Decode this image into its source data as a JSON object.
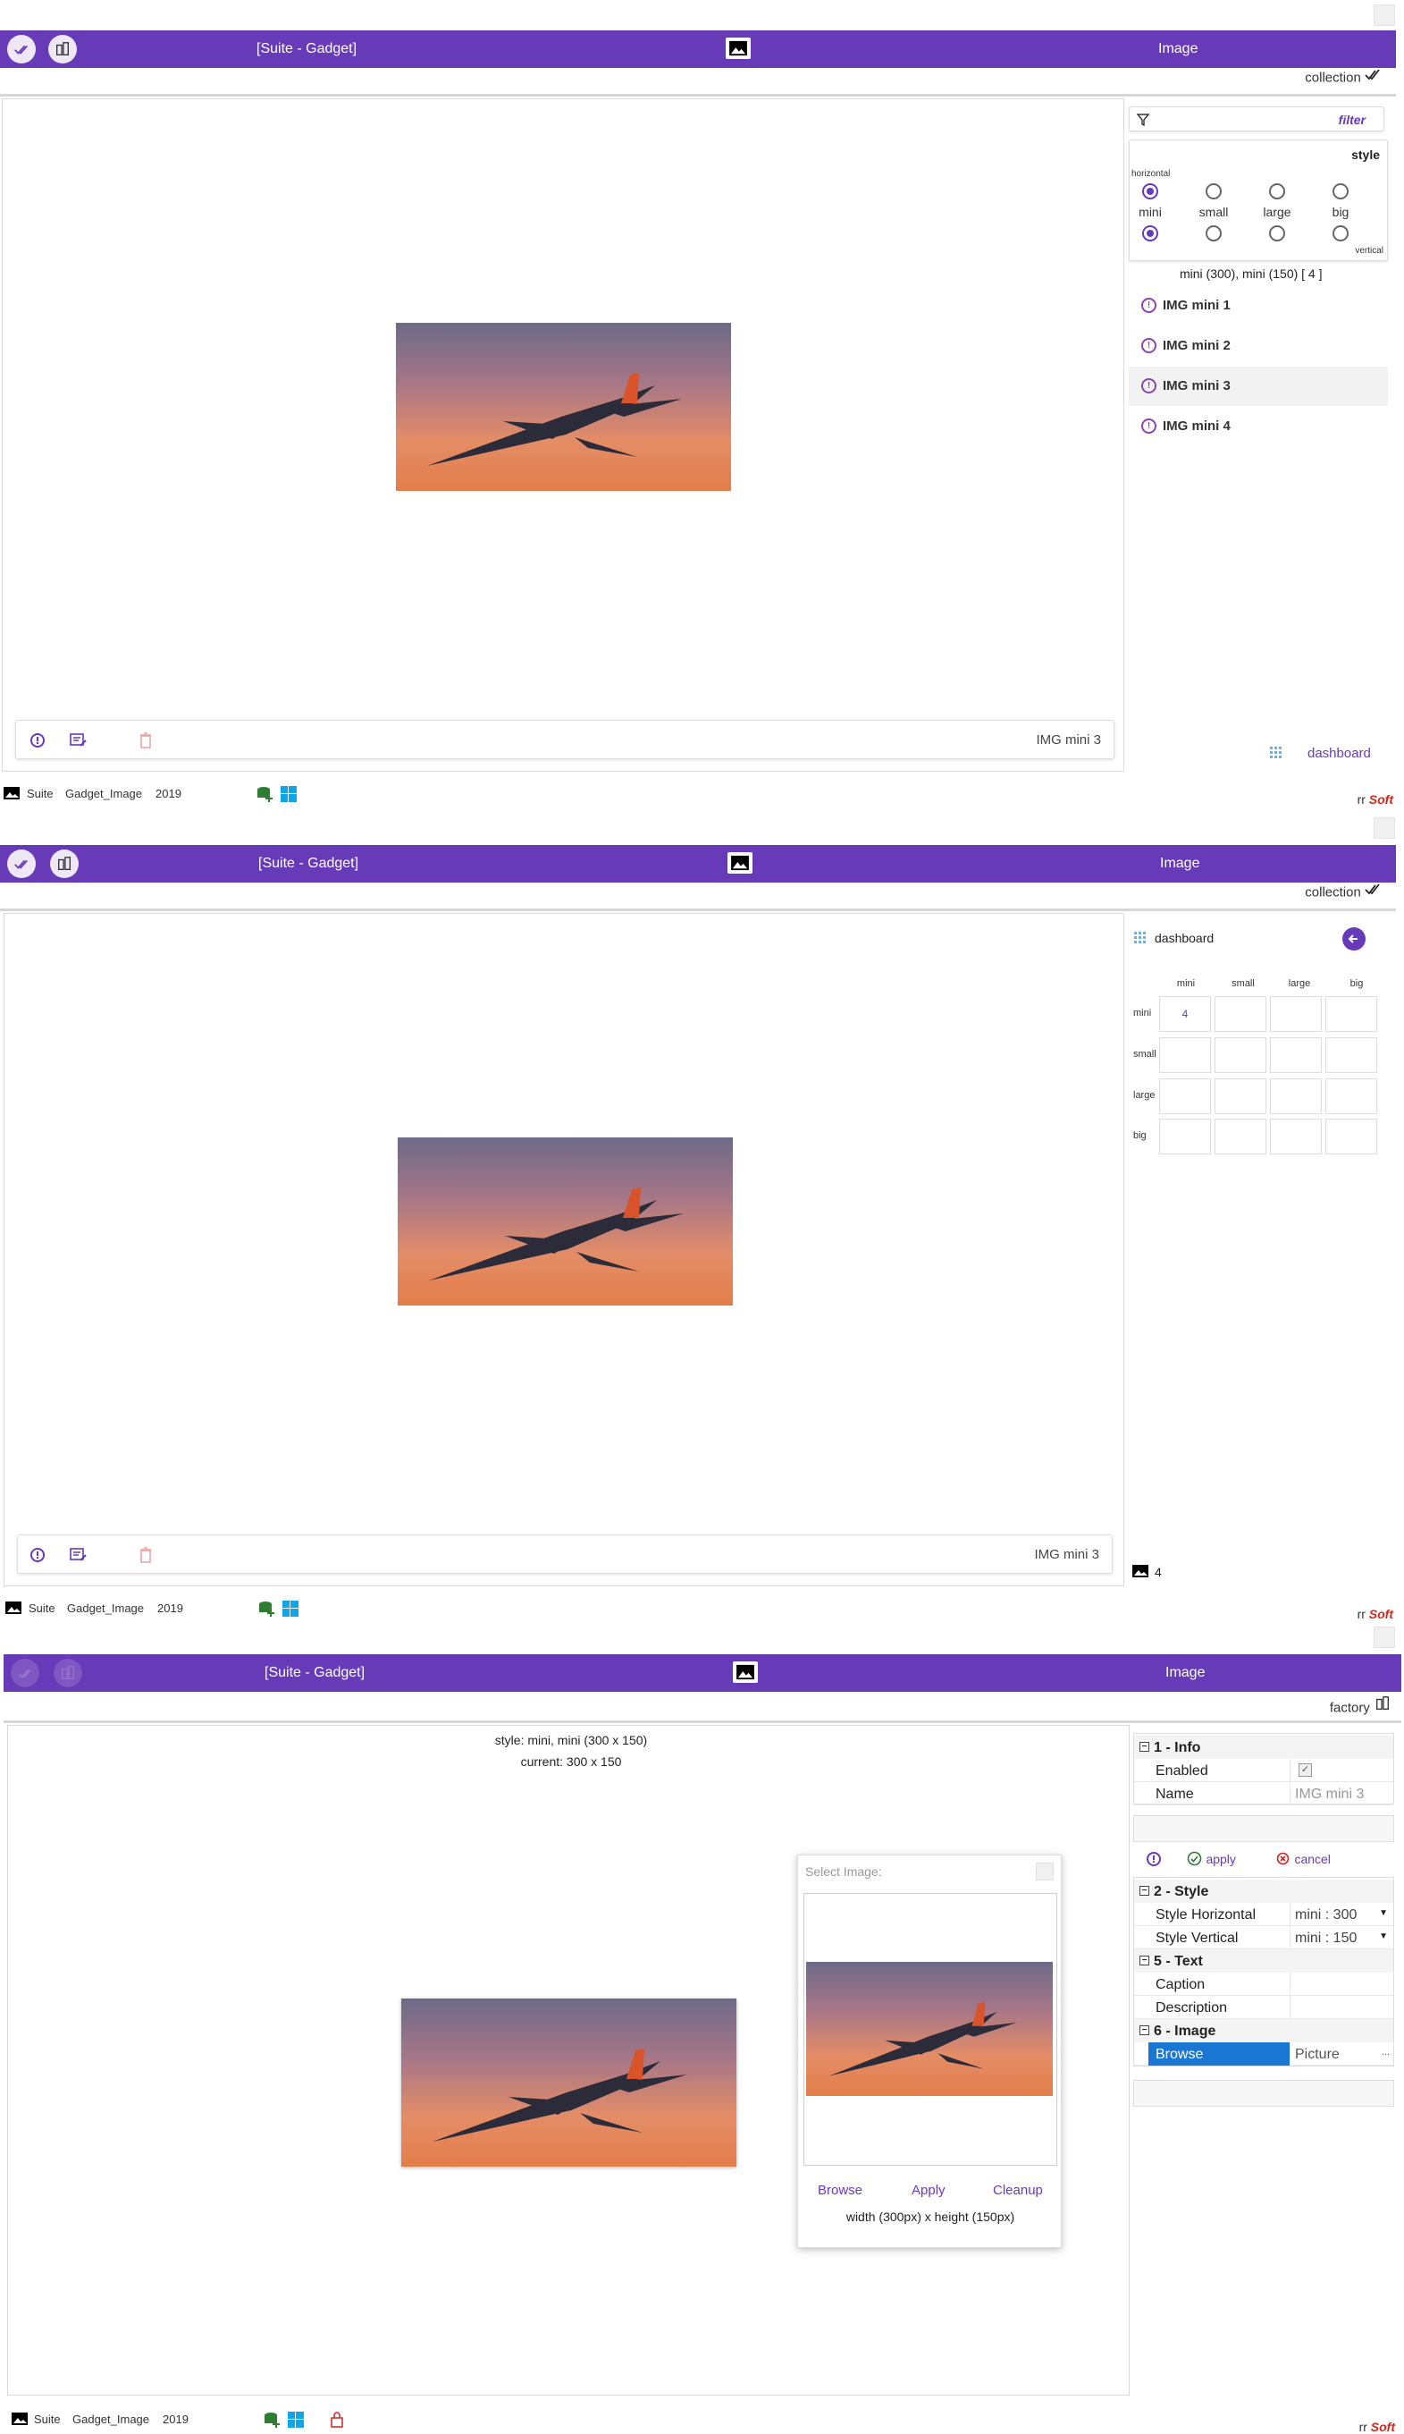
{
  "app": {
    "bar_title": "[Suite - Gadget]",
    "bar_right": "Image",
    "accent": "#673ab7",
    "footer": {
      "suite": "Suite",
      "name": "Gadget_Image",
      "year": "2019",
      "brand_rr": "rr",
      "brand_soft": "Soft"
    }
  },
  "screen1": {
    "sub_label": "collection",
    "filter_label": "filter",
    "style_title": "style",
    "horizontal_label": "horizontal",
    "vertical_label": "vertical",
    "sizes": [
      "mini",
      "small",
      "large",
      "big"
    ],
    "selected_horizontal": "mini",
    "selected_vertical": "mini",
    "summary": "mini (300), mini (150)  [ 4 ]",
    "items": [
      "IMG mini 1",
      "IMG mini 2",
      "IMG mini 3",
      "IMG mini 4"
    ],
    "selected_item": "IMG mini 3",
    "toolbar_label": "IMG mini 3",
    "dashboard_link": "dashboard"
  },
  "screen2": {
    "sub_label": "collection",
    "dashboard_title": "dashboard",
    "columns": [
      "mini",
      "small",
      "large",
      "big"
    ],
    "rows": [
      "mini",
      "small",
      "large",
      "big"
    ],
    "cell_mini_mini": "4",
    "toolbar_label": "IMG mini 3",
    "image_count": "4"
  },
  "screen3": {
    "sub_label": "factory",
    "style_line": "style: mini, mini (300 x 150)",
    "current_line": "current: 300 x 150",
    "section_info": "1 - Info",
    "enabled_label": "Enabled",
    "enabled_value": "✓",
    "name_label": "Name",
    "name_value": "IMG mini 3",
    "apply_label": "apply",
    "cancel_label": "cancel",
    "section_style": "2 - Style",
    "style_h_label": "Style Horizontal",
    "style_h_value": "mini : 300",
    "style_v_label": "Style Vertical",
    "style_v_value": "mini : 150",
    "section_text": "5 - Text",
    "caption_label": "Caption",
    "description_label": "Description",
    "section_image": "6 - Image",
    "browse_label": "Browse",
    "browse_value": "Picture",
    "browse_ellipsis": "...",
    "dialog_title": "Select Image:",
    "dialog_browse": "Browse",
    "dialog_apply": "Apply",
    "dialog_cleanup": "Cleanup",
    "dialog_size": "width (300px) x height (150px)"
  }
}
